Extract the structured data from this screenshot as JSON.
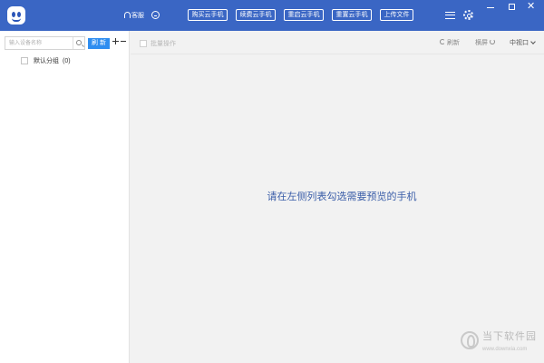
{
  "titlebar": {
    "customer_service": "客服",
    "buttons": [
      "购买云手机",
      "续费云手机",
      "重启云手机",
      "重置云手机",
      "上传文件"
    ],
    "window_controls": {
      "minimize": "—",
      "maximize": "□",
      "close": "✕"
    }
  },
  "sidebar": {
    "search_placeholder": "输入设备名称",
    "refresh_label": "刷 新",
    "groups": [
      {
        "label": "默认分组",
        "count": "(0)"
      }
    ]
  },
  "toolbar": {
    "batch_label": "批量操作",
    "refresh_label": "刷新",
    "rotate_label": "横屏",
    "view_label": "中视口"
  },
  "main": {
    "hint": "请在左侧列表勾选需要预览的手机"
  },
  "watermark": {
    "title": "当下软件园",
    "url": "www.downxia.com"
  },
  "colors": {
    "titlebar": "#3a66c4",
    "accent": "#2e8df0",
    "hint_text": "#3a5da8"
  },
  "icons": [
    "app-logo-icon",
    "headset-icon",
    "face-icon",
    "menu-icon",
    "gear-icon",
    "search-icon",
    "plus-icon",
    "minus-icon",
    "refresh-icon",
    "rotate-icon",
    "chevron-down-icon"
  ]
}
